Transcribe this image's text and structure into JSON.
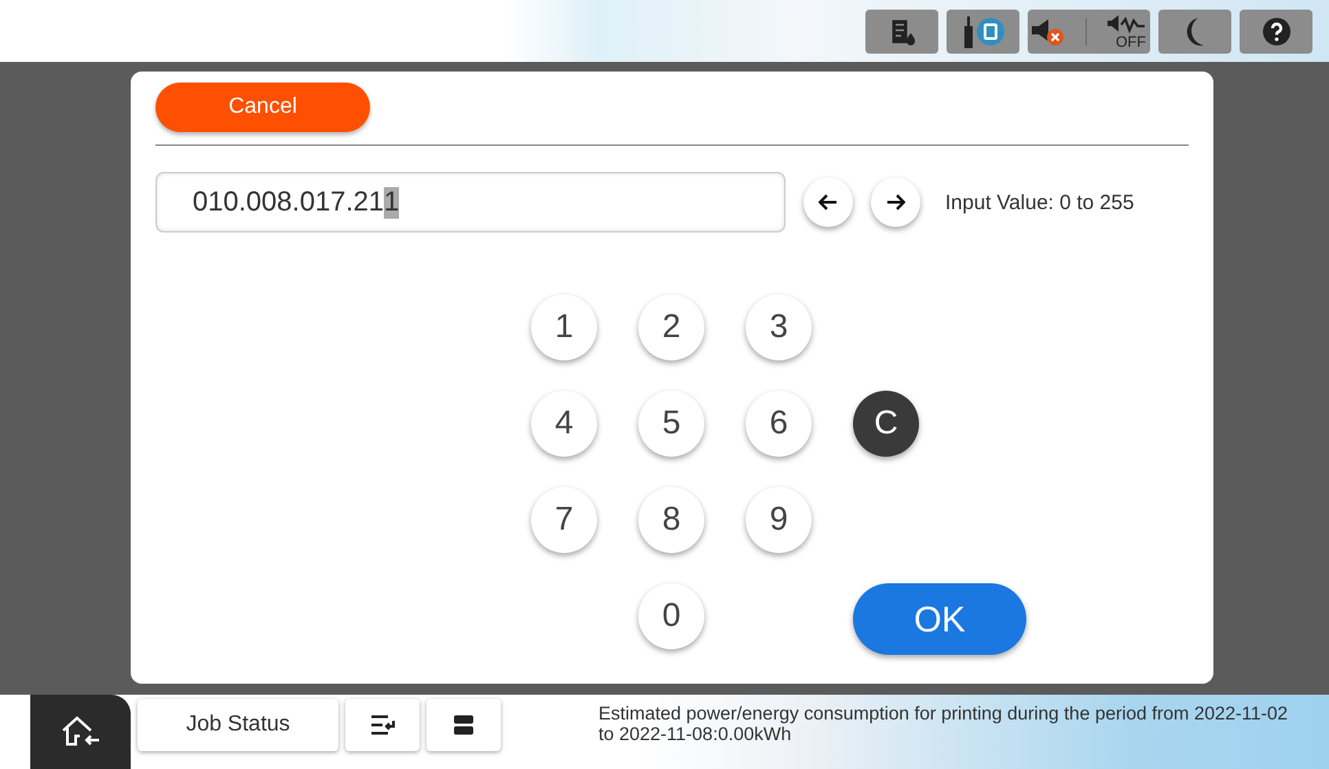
{
  "status_icons": [
    {
      "kind": "ink"
    },
    {
      "kind": "network"
    },
    {
      "kind": "sound",
      "parts": [
        {
          "kind": "mute"
        },
        {
          "kind": "off",
          "label": "OFF"
        }
      ]
    },
    {
      "kind": "sleep"
    },
    {
      "kind": "help"
    }
  ],
  "dialog": {
    "cancel": "Cancel",
    "field": {
      "value": "010.008.017.21",
      "selected_text": "1"
    },
    "hint": "Input Value: 0 to 255",
    "keys": [
      [
        {
          "kind": "digit",
          "label": "1"
        },
        {
          "kind": "digit",
          "label": "2"
        },
        {
          "kind": "digit",
          "label": "3"
        }
      ],
      [
        {
          "kind": "digit",
          "label": "4"
        },
        {
          "kind": "digit",
          "label": "5"
        },
        {
          "kind": "digit",
          "label": "6"
        },
        {
          "kind": "clear",
          "label": "C"
        }
      ],
      [
        {
          "kind": "digit",
          "label": "7"
        },
        {
          "kind": "digit",
          "label": "8"
        },
        {
          "kind": "digit",
          "label": "9"
        }
      ],
      [
        {
          "kind": "blank"
        },
        {
          "kind": "digit",
          "label": "0"
        },
        {
          "kind": "blank"
        },
        {
          "kind": "ok",
          "label": "OK"
        }
      ]
    ]
  },
  "bottom": {
    "job_status": "Job Status",
    "message": "Estimated power/energy consumption for printing during the period from 2022-11-02 to 2022-11-08:0.00kWh"
  }
}
